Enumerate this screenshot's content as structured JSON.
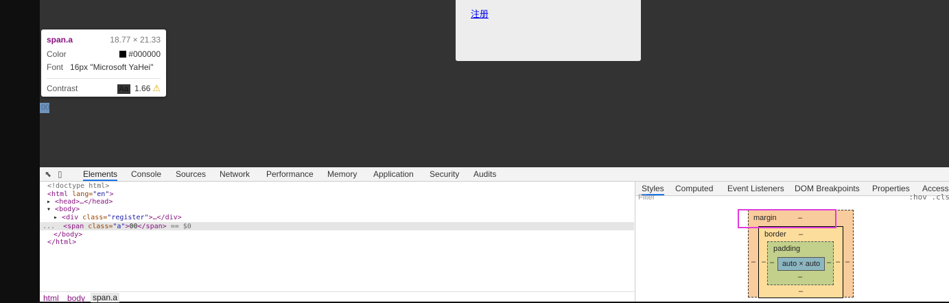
{
  "page": {
    "register_link": "注册",
    "span_content": "00"
  },
  "tooltip": {
    "selector": "span.a",
    "dimensions": "18.77 × 21.33",
    "color_label": "Color",
    "color_value": "#000000",
    "font_label": "Font",
    "font_value": "16px \"Microsoft YaHei\"",
    "contrast_label": "Contrast",
    "contrast_sample": "Aa",
    "contrast_value": "1.66",
    "warning_icon": "warning-icon"
  },
  "devtools": {
    "tabs": [
      "Elements",
      "Console",
      "Sources",
      "Network",
      "Performance",
      "Memory",
      "Application",
      "Security",
      "Audits"
    ],
    "active_tab": "Elements",
    "code": {
      "doctype": "<!doctype html>",
      "html_open_tag": "<html",
      "html_lang_attr": " lang=",
      "html_lang_val": "\"en\"",
      "gt": ">",
      "head": "<head>…</head>",
      "body_open": "<body>",
      "div_open": "<div",
      "div_class_attr": " class=",
      "div_class_val": "\"register\"",
      "div_rest": ">…</div>",
      "span_open": "<span",
      "span_class_attr": " class=",
      "span_class_val": "\"a\"",
      "span_gt": ">",
      "span_text": "00",
      "span_close": "</span>",
      "dollar": " == $0",
      "body_close": "</body>",
      "html_close": "</html>",
      "ellipsis": "..."
    },
    "breadcrumb": [
      "html",
      "body",
      "span.a"
    ],
    "side_tabs": [
      "Styles",
      "Computed",
      "Event Listeners",
      "DOM Breakpoints",
      "Properties",
      "Accessi"
    ],
    "filter_placeholder": "Filter",
    "hov_cls": ":hov .cls",
    "box_model": {
      "margin_label": "margin",
      "border_label": "border",
      "padding_label": "padding",
      "content": "auto × auto",
      "dash": "–"
    }
  }
}
